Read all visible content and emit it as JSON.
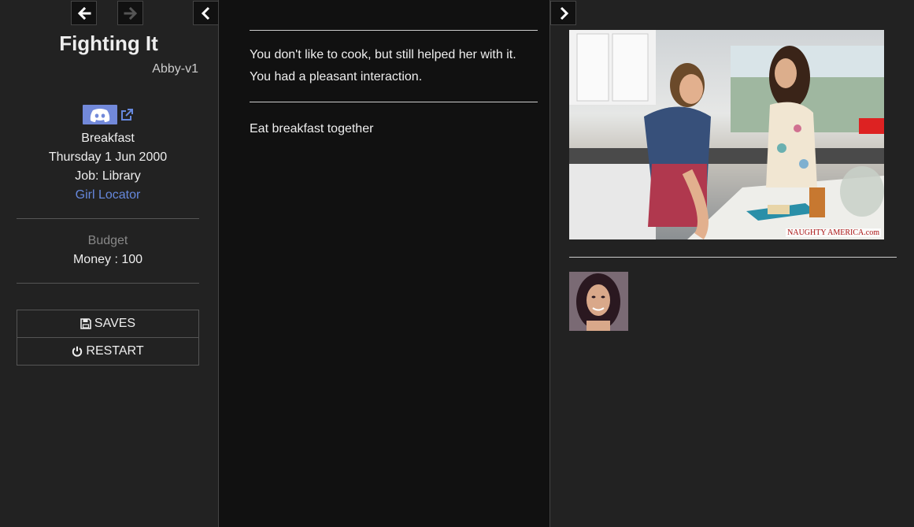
{
  "sidebar": {
    "title": "Fighting It",
    "subtitle": "Abby-v1",
    "time_of_day": "Breakfast",
    "date": "Thursday 1 Jun 2000",
    "job": "Job: Library",
    "girl_locator": "Girl Locator",
    "budget_label": "Budget",
    "money": "Money : 100",
    "saves_label": "SAVES",
    "restart_label": "RESTART"
  },
  "passage": {
    "lines": [
      "You don't like to cook, but still helped her with it.",
      "You had a pleasant interaction."
    ],
    "link": "Eat breakfast together"
  },
  "right_panel": {
    "watermark": "NAUGHTY AMERICA.com"
  },
  "icons": {
    "back": "arrow-left-icon",
    "forward": "arrow-right-icon",
    "collapse_left": "chevron-left-icon",
    "collapse_right": "chevron-right-icon",
    "discord": "discord-icon",
    "external": "external-link-icon",
    "save": "floppy-disk-icon",
    "restart": "power-icon"
  },
  "colors": {
    "link": "#6688dd",
    "discord": "#7289da",
    "sidebar_bg": "#222222",
    "main_bg": "#111111"
  }
}
